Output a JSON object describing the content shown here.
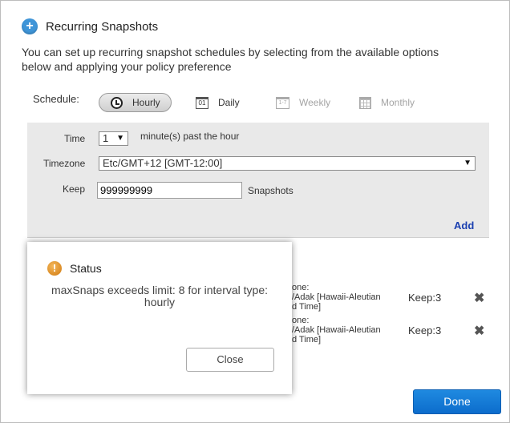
{
  "dialog": {
    "title": "Recurring Snapshots",
    "intro": "You can set up recurring snapshot schedules by selecting from the available options below and applying your policy preference"
  },
  "schedule": {
    "label": "Schedule:",
    "options": [
      {
        "label": "Hourly",
        "icon": "clock-icon",
        "active": true
      },
      {
        "label": "Daily",
        "icon": "calendar-icon",
        "icon_text": "01"
      },
      {
        "label": "Weekly",
        "icon": "calendar-week-icon",
        "icon_text": "1-7"
      },
      {
        "label": "Monthly",
        "icon": "calendar-month-icon"
      }
    ]
  },
  "form": {
    "time_label": "Time",
    "time_value": "1",
    "time_suffix": "minute(s) past the hour",
    "timezone_label": "Timezone",
    "timezone_value": "Etc/GMT+12 [GMT-12:00]",
    "keep_label": "Keep",
    "keep_value": "999999999",
    "keep_suffix": "Snapshots",
    "add_label": "Add"
  },
  "policies": [
    {
      "line1": "one:",
      "line2": "/Adak [Hawaii-Aleutian",
      "line3": "d Time]",
      "keep": "Keep:3"
    },
    {
      "line1": "one:",
      "line2": "/Adak [Hawaii-Aleutian",
      "line3": "d Time]",
      "keep": "Keep:3"
    }
  ],
  "done_label": "Done",
  "status_dialog": {
    "title": "Status",
    "message": "maxSnaps exceeds limit: 8 for interval type: hourly",
    "close_label": "Close"
  },
  "colors": {
    "accent": "#1f8ae0",
    "link": "#1a3fb0",
    "panel": "#e9e9e9",
    "warning": "#d07a10"
  }
}
